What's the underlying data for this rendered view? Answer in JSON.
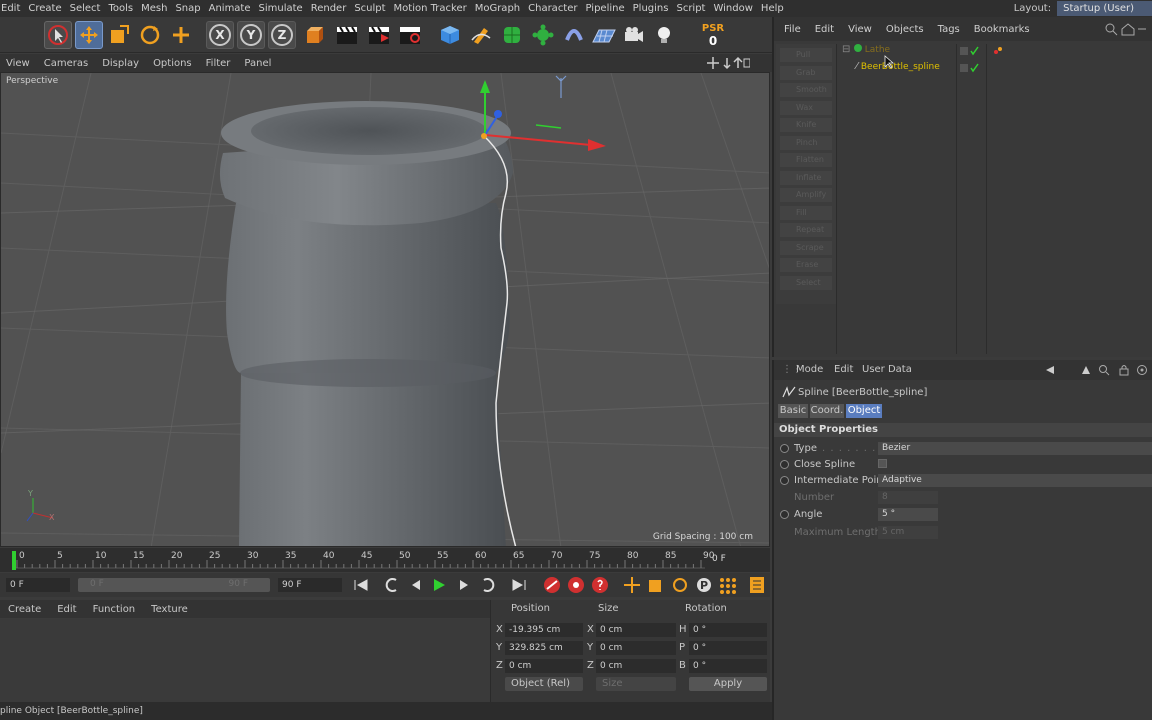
{
  "menubar": {
    "items": [
      "Edit",
      "Create",
      "Select",
      "Tools",
      "Mesh",
      "Snap",
      "Animate",
      "Simulate",
      "Render",
      "Sculpt",
      "Motion Tracker",
      "MoGraph",
      "Character",
      "Pipeline",
      "Plugins",
      "Script",
      "Window",
      "Help"
    ],
    "layout_label": "Layout:",
    "layout_value": "Startup (User)"
  },
  "toolbar": {
    "x_label": "X",
    "y_label": "Y",
    "z_label": "Z",
    "psr_label": "PSR",
    "psr_value": "0"
  },
  "viewport": {
    "menu": [
      "View",
      "Cameras",
      "Display",
      "Options",
      "Filter",
      "Panel"
    ],
    "label": "Perspective",
    "grid_spacing": "Grid Spacing : 100 cm",
    "axis_x": "X",
    "axis_y": "Y"
  },
  "timeline": {
    "ticks": [
      "0",
      "5",
      "10",
      "15",
      "20",
      "25",
      "30",
      "35",
      "40",
      "45",
      "50",
      "55",
      "60",
      "65",
      "70",
      "75",
      "80",
      "85",
      "90"
    ],
    "current_frame": "0 F",
    "start_field": "0 F",
    "range_start": "0 F",
    "range_end": "90 F",
    "end_field": "90 F",
    "play_progress": 0
  },
  "material": {
    "menu": [
      "Create",
      "Edit",
      "Function",
      "Texture"
    ]
  },
  "coords": {
    "headers": [
      "Position",
      "Size",
      "Rotation"
    ],
    "rows": [
      {
        "axis": "X",
        "pos": "-19.395 cm",
        "saxis": "X",
        "size": "0 cm",
        "raxis": "H",
        "rot": "0 °"
      },
      {
        "axis": "Y",
        "pos": "329.825 cm",
        "saxis": "Y",
        "size": "0 cm",
        "raxis": "P",
        "rot": "0 °"
      },
      {
        "axis": "Z",
        "pos": "0 cm",
        "saxis": "Z",
        "size": "0 cm",
        "raxis": "B",
        "rot": "0 °"
      }
    ],
    "mode_select": "Object (Rel)",
    "size_select": "Size",
    "apply_label": "Apply"
  },
  "status": "pline Object [BeerBottle_spline]",
  "object_manager": {
    "menu": [
      "File",
      "Edit",
      "View",
      "Objects",
      "Tags",
      "Bookmarks"
    ],
    "objects": [
      {
        "name": "Lathe",
        "color": "#d0a000"
      },
      {
        "name": "BeerBottle_spline",
        "color": "#e0c000"
      }
    ],
    "side_tools": [
      "Pull",
      "Grab",
      "Smooth",
      "Wax",
      "Knife",
      "Pinch",
      "Flatten",
      "Inflate",
      "Amplify",
      "Fill",
      "Repeat",
      "Scrape",
      "Erase",
      "Select"
    ]
  },
  "attributes": {
    "menu": [
      "Mode",
      "Edit",
      "User Data"
    ],
    "object_title": "Spline [BeerBottle_spline]",
    "tabs": [
      "Basic",
      "Coord.",
      "Object"
    ],
    "active_tab": "Object",
    "section": "Object Properties",
    "props": [
      {
        "label": "Type",
        "value": "Bezier"
      },
      {
        "label": "Close Spline",
        "value": ""
      },
      {
        "label": "Intermediate Points",
        "value": "Adaptive"
      },
      {
        "label": "Number",
        "value": "8"
      },
      {
        "label": "Angle",
        "value": "5 °"
      },
      {
        "label": "Maximum Length",
        "value": "5 cm"
      }
    ]
  },
  "colors": {
    "accent": "#4b5a74",
    "active_tab": "#5a7dbf",
    "axis_x": "#e03030",
    "axis_y": "#30d030",
    "axis_z": "#3060e0"
  }
}
